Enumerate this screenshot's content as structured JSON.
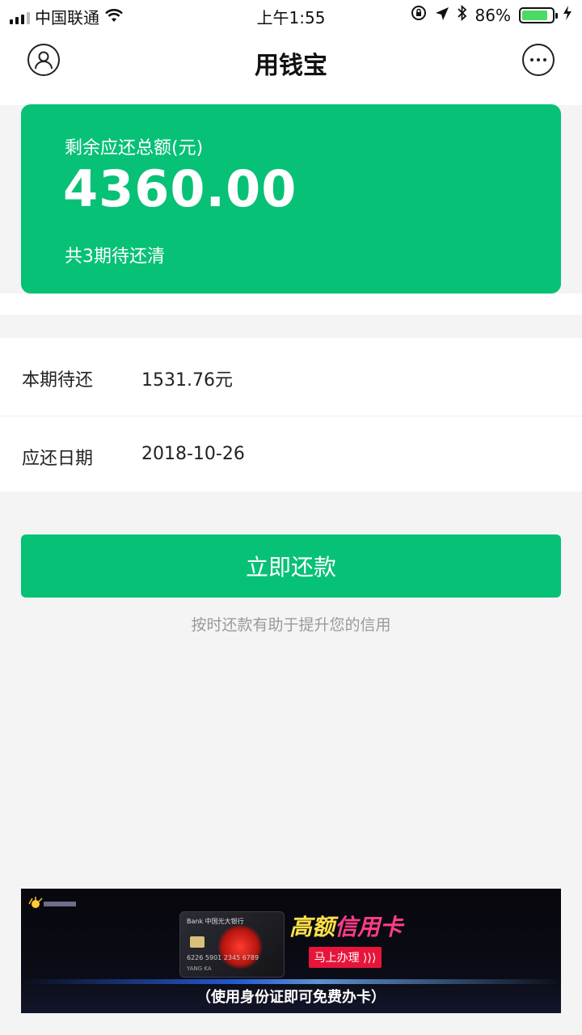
{
  "status_bar": {
    "carrier": "中国联通",
    "time": "上午1:55",
    "battery_percent": "86%",
    "battery_level": 0.86,
    "icons": [
      "signal-icon",
      "wifi-icon",
      "orientation-lock-icon",
      "location-icon",
      "bluetooth-icon",
      "battery-icon",
      "charging-icon"
    ]
  },
  "nav": {
    "title": "用钱宝",
    "left_icon": "user-profile-icon",
    "right_icon": "more-options-icon"
  },
  "summary_card": {
    "label": "剩余应还总额(元)",
    "amount": "4360.00",
    "note": "共3期待还清",
    "color": "#07c176"
  },
  "details": [
    {
      "key": "本期待还",
      "value": "1531.76元"
    },
    {
      "key": "应还日期",
      "value": "2018-10-26"
    }
  ],
  "actions": {
    "repay_label": "立即还款",
    "hint": "按时还款有助于提升您的信用"
  },
  "ad_banner": {
    "headline_part1": "高额",
    "headline_part2": "信用卡",
    "cta": "马上办理 ⟩⟩⟩",
    "footer": "（使用身份证即可免费办卡）",
    "card_bank": "Bank 中国光大银行",
    "card_number": "6226 5901 2345 6789",
    "card_holder": "YANG KA"
  }
}
